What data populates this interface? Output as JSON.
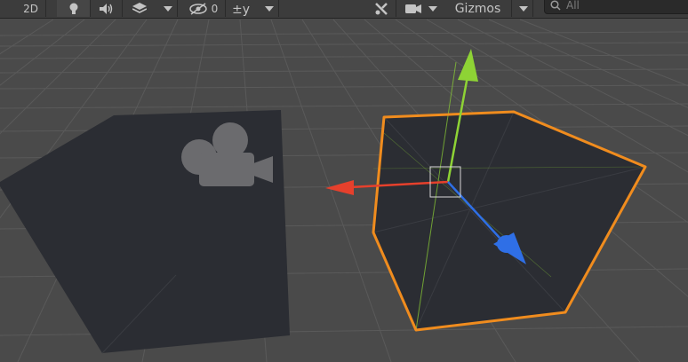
{
  "toolbar": {
    "mode_2d_label": "2D",
    "hidden_count": "0",
    "gizmos_label": "Gizmos",
    "search_placeholder": "All",
    "icons": [
      "bulb-icon",
      "audio-icon",
      "layers-icon",
      "visibility-icon",
      "grid-snap-icon",
      "tools-icon",
      "camera-icon",
      "search-icon"
    ]
  },
  "scene": {
    "selected_object": "cube",
    "camera_gizmo": "camera-icon",
    "colors": {
      "background": "#4a4a4a",
      "grid": "#5a5a5a",
      "object_fill": "#2b2d33",
      "selection_outline": "#f08c1e",
      "axis_x": "#e6402c",
      "axis_y": "#8ed335",
      "axis_z": "#2f6fe6"
    }
  }
}
